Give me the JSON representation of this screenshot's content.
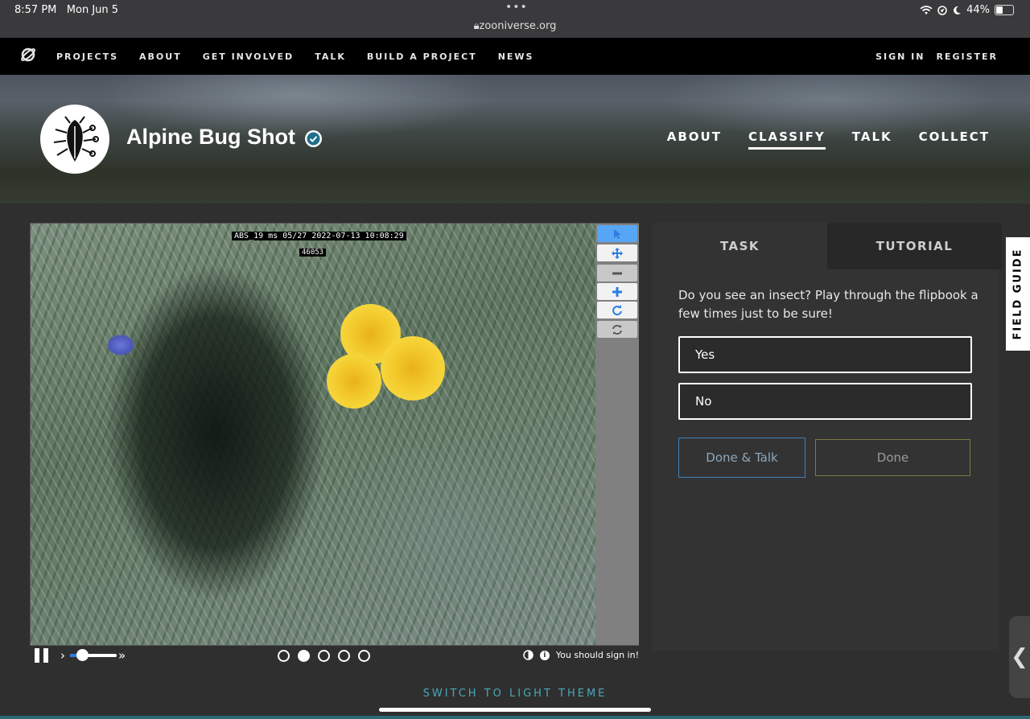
{
  "status_bar": {
    "time": "8:57 PM",
    "date": "Mon Jun 5",
    "dots": "•••",
    "url": "zooniverse.org",
    "battery": "44%",
    "battery_level": 0.44,
    "icons": [
      "wifi-icon",
      "location-icon",
      "moon-icon",
      "battery-icon"
    ]
  },
  "site_nav": {
    "links": [
      "PROJECTS",
      "ABOUT",
      "GET INVOLVED",
      "TALK",
      "BUILD A PROJECT",
      "NEWS"
    ],
    "sign_in": "SIGN IN",
    "register": "REGISTER"
  },
  "project": {
    "title": "Alpine Bug Shot",
    "verified_icon": "check-badge-icon",
    "nav": [
      "ABOUT",
      "CLASSIFY",
      "TALK",
      "COLLECT"
    ],
    "active_nav": "CLASSIFY"
  },
  "viewer": {
    "image_stamp": "ABS_19 ms 05/27 2022-07-13 10:08:29",
    "image_stamp2": "46053",
    "tools": [
      "pointer-icon",
      "move-icon",
      "zoom-out-icon",
      "zoom-in-icon",
      "rotate-icon",
      "reset-icon"
    ],
    "playback": {
      "pause_icon": "pause-icon",
      "slow": "›",
      "fast": "»",
      "speed_fraction": 0.25
    },
    "frames": 5,
    "current_frame": 2,
    "signin_note": "You should sign in!",
    "note_icons": [
      "contrast-icon",
      "info-icon"
    ]
  },
  "task_panel": {
    "tabs": [
      "TASK",
      "TUTORIAL"
    ],
    "question": "Do you see an insect? Play through the flipbook a few times just to be sure!",
    "answers": [
      "Yes",
      "No"
    ],
    "done_talk": "Done & Talk",
    "done": "Done"
  },
  "field_guide": "FIELD GUIDE",
  "side_handle": "❮",
  "footer": {
    "light_theme": "SWITCH TO LIGHT THEME"
  },
  "colors": {
    "accent_blue": "#2a7de1",
    "theme_link": "#4aa8b8",
    "done_talk_border": "#3f7fb8",
    "done_border": "#7d7a48"
  }
}
